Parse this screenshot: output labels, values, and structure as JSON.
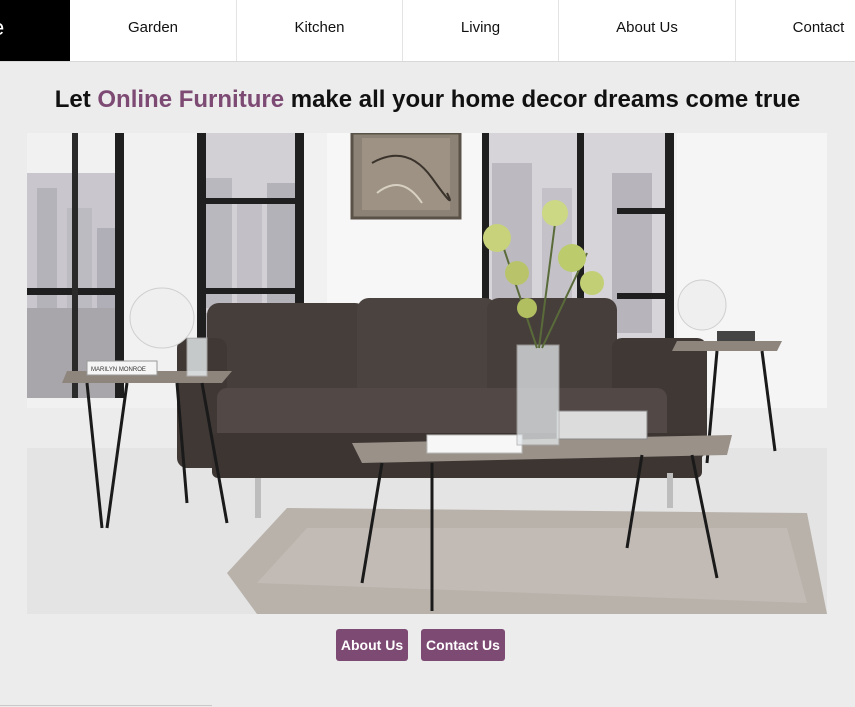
{
  "logo": {
    "fragment": "e"
  },
  "nav": {
    "items": [
      {
        "label": "Garden"
      },
      {
        "label": "Kitchen"
      },
      {
        "label": "Living"
      },
      {
        "label": "About Us"
      },
      {
        "label": "Contact"
      }
    ]
  },
  "headline": {
    "prefix": "Let ",
    "brand": "Online Furniture",
    "suffix": " make all your home decor dreams come true"
  },
  "hero": {
    "book_title": "MARILYN MONROE"
  },
  "buttons": {
    "about_label": "About Us",
    "contact_label": "Contact Us"
  },
  "colors": {
    "accent": "#7d4a74",
    "background": "#ececec",
    "logo_bg": "#000000"
  }
}
